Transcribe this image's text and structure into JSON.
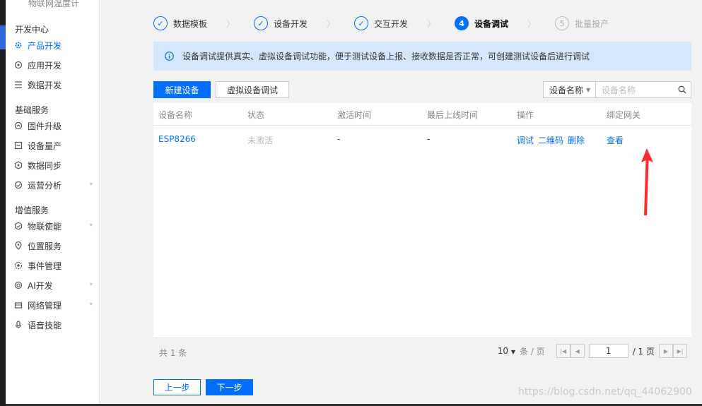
{
  "sidebar": {
    "top_item": "物联网温度计",
    "groups": [
      {
        "title": "开发中心",
        "items": [
          {
            "label": "产品开发",
            "icon": "gear-icon",
            "active": true
          },
          {
            "label": "应用开发",
            "icon": "app-icon"
          },
          {
            "label": "数据开发",
            "icon": "list-icon"
          }
        ]
      },
      {
        "title": "基础服务",
        "items": [
          {
            "label": "固件升级",
            "icon": "upgrade-icon"
          },
          {
            "label": "设备量产",
            "icon": "device-icon"
          },
          {
            "label": "数据同步",
            "icon": "sync-icon"
          },
          {
            "label": "运营分析",
            "icon": "analytics-icon",
            "expandable": true
          }
        ]
      },
      {
        "title": "增值服务",
        "items": [
          {
            "label": "物联使能",
            "icon": "enable-icon",
            "expandable": true
          },
          {
            "label": "位置服务",
            "icon": "location-icon"
          },
          {
            "label": "事件管理",
            "icon": "event-icon"
          },
          {
            "label": "AI开发",
            "icon": "ai-icon",
            "expandable": true
          },
          {
            "label": "网络管理",
            "icon": "network-icon",
            "expandable": true
          },
          {
            "label": "语音技能",
            "icon": "voice-icon"
          }
        ]
      }
    ]
  },
  "stepper": {
    "steps": [
      {
        "label": "数据模板",
        "state": "done",
        "marker": "✓"
      },
      {
        "label": "设备开发",
        "state": "done",
        "marker": "✓"
      },
      {
        "label": "交互开发",
        "state": "done",
        "marker": "✓"
      },
      {
        "label": "设备调试",
        "state": "current",
        "marker": "4"
      },
      {
        "label": "批量投产",
        "state": "pending",
        "marker": "5"
      }
    ],
    "separator": "〉"
  },
  "info": {
    "text": "设备调试提供真实、虚拟设备调试功能，便于测试设备上报、接收数据是否正常，可创建测试设备后进行调试"
  },
  "toolbar": {
    "new_device": "新建设备",
    "virtual_debug": "虚拟设备调试",
    "search_field": "设备名称",
    "search_placeholder": "设备名称"
  },
  "table": {
    "columns": [
      "设备名称",
      "状态",
      "激活时间",
      "最后上线时间",
      "操作",
      "绑定网关"
    ],
    "rows": [
      {
        "name": "ESP8266",
        "status": "未激活",
        "activated": "-",
        "last_online": "-",
        "actions": [
          "调试",
          "二维码",
          "删除"
        ],
        "gateway": "查看"
      }
    ]
  },
  "footer": {
    "total": "共 1 条",
    "page_size": "10",
    "page_size_suffix": "条 / 页",
    "current_page": "1",
    "total_pages": "/ 1 页"
  },
  "nav_buttons": {
    "prev": "上一步",
    "next": "下一步"
  },
  "watermark": "https://blog.csdn.net/qq_44062900",
  "colors": {
    "accent": "#006eff",
    "info_bg": "#d5e7fd",
    "arrow": "#ff2a2a"
  }
}
